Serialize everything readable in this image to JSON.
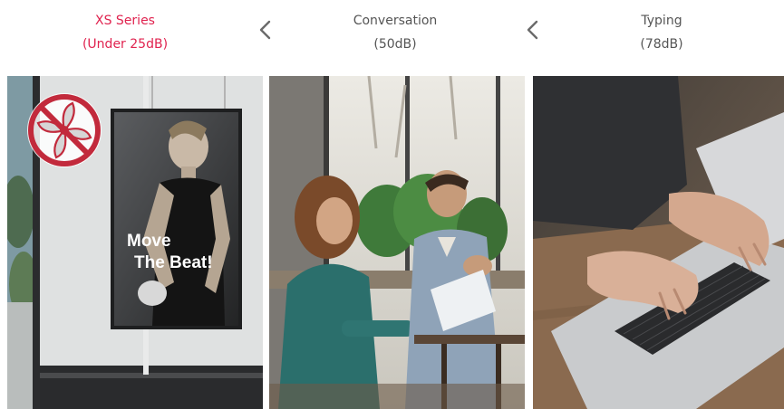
{
  "levels": [
    {
      "title": "XS Series",
      "subtitle": "(Under 25dB)",
      "color": "#e0234f"
    },
    {
      "title": "Conversation",
      "subtitle": "(50dB)",
      "color": "#555555"
    },
    {
      "title": "Typing",
      "subtitle": "(78dB)",
      "color": "#555555"
    }
  ],
  "poster": {
    "line1": "Move",
    "line2": "The Beat!"
  },
  "icons": {
    "no_fan": "no-fan-icon",
    "separator": "chevron-left-icon"
  }
}
